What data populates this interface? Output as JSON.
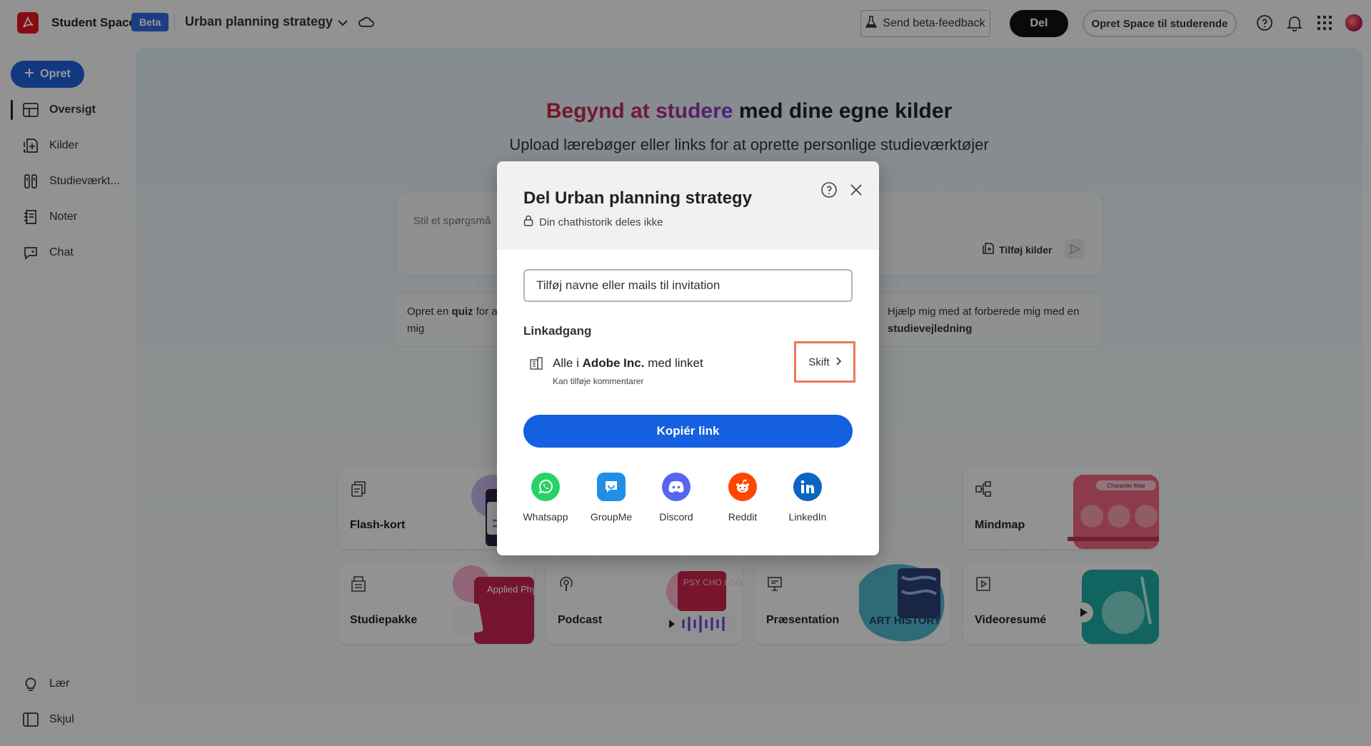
{
  "header": {
    "app_name": "Student Spaces",
    "beta_label": "Beta",
    "project_title": "Urban planning strategy",
    "feedback_label": "Send beta-feedback",
    "share_label": "Del",
    "create_space_label": "Opret Space til studerende"
  },
  "sidebar": {
    "create_label": "Opret",
    "items": [
      {
        "label": "Oversigt",
        "icon": "overview-icon"
      },
      {
        "label": "Kilder",
        "icon": "sources-icon"
      },
      {
        "label": "Studieværkt...",
        "icon": "study-tools-icon"
      },
      {
        "label": "Noter",
        "icon": "notes-icon"
      },
      {
        "label": "Chat",
        "icon": "chat-icon"
      }
    ],
    "bottom_items": [
      {
        "label": "Lær",
        "icon": "lightbulb-icon"
      },
      {
        "label": "Skjul",
        "icon": "collapse-panel-icon"
      }
    ]
  },
  "main": {
    "hero_title_highlight": "Begynd at studere",
    "hero_title_rest": " med dine egne kilder",
    "hero_subtitle": "Upload lærebøger eller links for at oprette personlige studieværktøjer",
    "ask_placeholder": "Stil et spørgsmå",
    "add_sources_label": "Tilføj kilder",
    "suggestion_left_a": "Opret en ",
    "suggestion_left_bold": "quiz",
    "suggestion_left_b": " for at",
    "suggestion_left_c": "mig",
    "suggestion_right_a": "Hjælp mig med at forberede mig med en",
    "suggestion_right_bold": "studievejledning",
    "tools": [
      {
        "label": "Flash-kort",
        "icon": "flashcards-icon"
      },
      {
        "label": "Mindmap",
        "icon": "mindmap-icon",
        "art_text": "Character Map"
      },
      {
        "label": "Studiepakke",
        "icon": "study-pack-icon",
        "art_text": "Applied Physics"
      },
      {
        "label": "Podcast",
        "icon": "podcast-icon",
        "art_text": "PSY CHO LOGY"
      },
      {
        "label": "Præsentation",
        "icon": "presentation-icon",
        "art_text": "ART HISTORY"
      },
      {
        "label": "Videoresumé",
        "icon": "video-summary-icon"
      }
    ]
  },
  "modal": {
    "title": "Del Urban planning strategy",
    "privacy_note": "Din chathistorik deles ikke",
    "invite_placeholder": "Tilføj navne eller mails til invitation",
    "link_access_label": "Linkadgang",
    "access_prefix": "Alle i ",
    "access_org": "Adobe Inc.",
    "access_suffix": " med linket",
    "access_permission": "Kan tilføje kommentarer",
    "change_label": "Skift",
    "copy_link_label": "Kopiér link",
    "share_targets": [
      {
        "label": "Whatsapp",
        "color": "#25d366"
      },
      {
        "label": "GroupMe",
        "color": "#1f8fe8"
      },
      {
        "label": "Discord",
        "color": "#5865f2"
      },
      {
        "label": "Reddit",
        "color": "#ff4500"
      },
      {
        "label": "LinkedIn",
        "color": "#0a66c2"
      }
    ]
  }
}
